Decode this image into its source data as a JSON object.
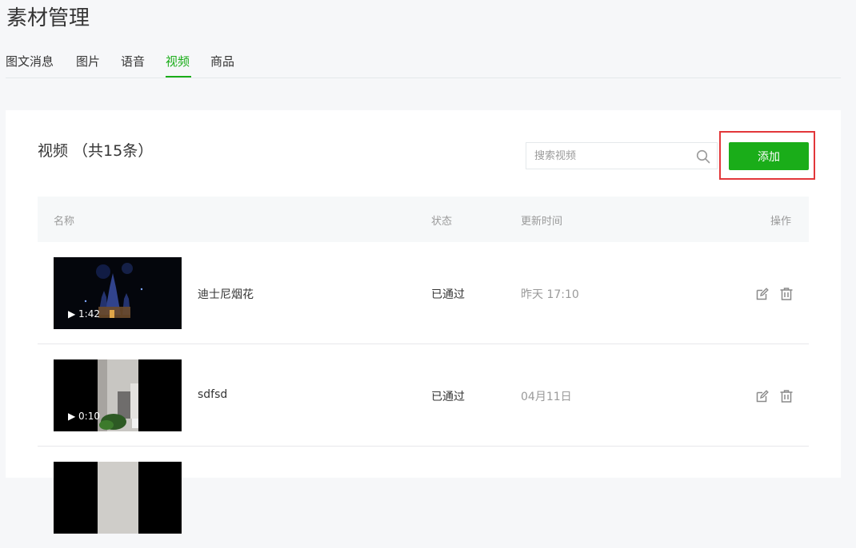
{
  "page_title": "素材管理",
  "tabs": [
    {
      "label": "图文消息"
    },
    {
      "label": "图片"
    },
    {
      "label": "语音"
    },
    {
      "label": "视频",
      "active": true
    },
    {
      "label": "商品"
    }
  ],
  "section_title": "视频 （共15条）",
  "search": {
    "placeholder": "搜索视频",
    "value": "",
    "icon": "search-icon"
  },
  "add_button": "添加",
  "table": {
    "columns": [
      "名称",
      "状态",
      "更新时间",
      "操作"
    ],
    "rows": [
      {
        "name": "迪士尼烟花",
        "status": "已通过",
        "time": "昨天 17:10",
        "duration": "▶ 1:42"
      },
      {
        "name": "sdfsd",
        "status": "已通过",
        "time": "04月11日",
        "duration": "▶ 0:10"
      }
    ]
  },
  "colors": {
    "accent": "#1aad19",
    "highlight": "#e2373a",
    "text": "#353535",
    "muted": "#9a9a9a"
  },
  "icons": {
    "edit": "edit-icon",
    "delete": "trash-icon"
  }
}
